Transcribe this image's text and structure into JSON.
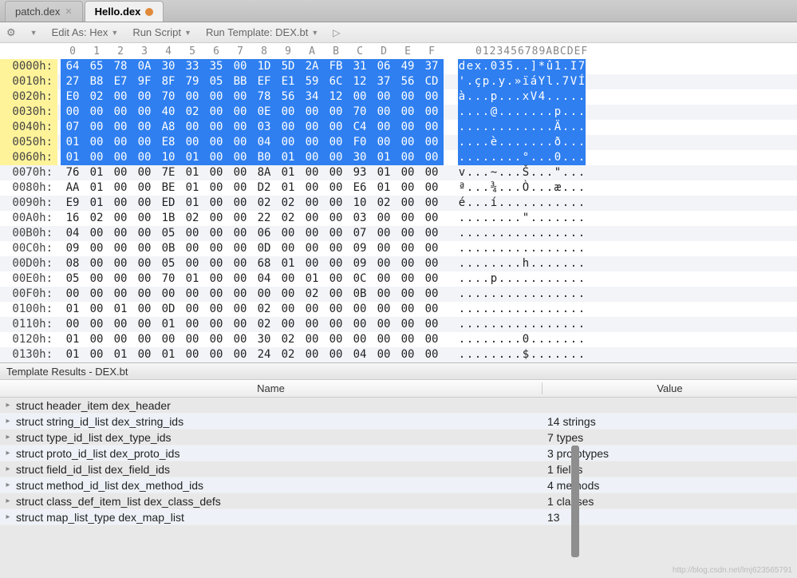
{
  "tabs": [
    {
      "label": "patch.dex",
      "active": false
    },
    {
      "label": "Hello.dex",
      "active": true,
      "dirty": true
    }
  ],
  "toolbar": {
    "edit_as": "Edit As: Hex",
    "run_script": "Run Script",
    "run_template": "Run Template: DEX.bt"
  },
  "hex_header": {
    "cols": [
      "0",
      "1",
      "2",
      "3",
      "4",
      "5",
      "6",
      "7",
      "8",
      "9",
      "A",
      "B",
      "C",
      "D",
      "E",
      "F"
    ],
    "ascii": "0123456789ABCDEF"
  },
  "rows": [
    {
      "addr": "0000h:",
      "hex": [
        "64",
        "65",
        "78",
        "0A",
        "30",
        "33",
        "35",
        "00",
        "1D",
        "5D",
        "2A",
        "FB",
        "31",
        "06",
        "49",
        "37"
      ],
      "asc": [
        "d",
        "e",
        "x",
        ".",
        "0",
        "3",
        "5",
        ".",
        ".",
        "]",
        "*",
        "û",
        "1",
        ".",
        "I",
        "7"
      ],
      "sel": true
    },
    {
      "addr": "0010h:",
      "hex": [
        "27",
        "B8",
        "E7",
        "9F",
        "8F",
        "79",
        "05",
        "BB",
        "EF",
        "E1",
        "59",
        "6C",
        "12",
        "37",
        "56",
        "CD"
      ],
      "asc": [
        "'",
        ".",
        "ç",
        "p",
        ".",
        "y",
        ".",
        "»",
        "ï",
        "á",
        "Y",
        "l",
        ".",
        "7",
        "V",
        "Í"
      ],
      "sel": true
    },
    {
      "addr": "0020h:",
      "hex": [
        "E0",
        "02",
        "00",
        "00",
        "70",
        "00",
        "00",
        "00",
        "78",
        "56",
        "34",
        "12",
        "00",
        "00",
        "00",
        "00"
      ],
      "asc": [
        "à",
        ".",
        ".",
        ".",
        "p",
        ".",
        ".",
        ".",
        "x",
        "V",
        "4",
        ".",
        ".",
        ".",
        ".",
        "."
      ],
      "sel": true
    },
    {
      "addr": "0030h:",
      "hex": [
        "00",
        "00",
        "00",
        "00",
        "40",
        "02",
        "00",
        "00",
        "0E",
        "00",
        "00",
        "00",
        "70",
        "00",
        "00",
        "00"
      ],
      "asc": [
        ".",
        ".",
        ".",
        ".",
        "@",
        ".",
        ".",
        ".",
        ".",
        ".",
        ".",
        ".",
        "p",
        ".",
        ".",
        "."
      ],
      "sel": true
    },
    {
      "addr": "0040h:",
      "hex": [
        "07",
        "00",
        "00",
        "00",
        "A8",
        "00",
        "00",
        "00",
        "03",
        "00",
        "00",
        "00",
        "C4",
        "00",
        "00",
        "00"
      ],
      "asc": [
        ".",
        ".",
        ".",
        ".",
        ".",
        ".",
        ".",
        ".",
        ".",
        ".",
        ".",
        ".",
        "Ä",
        ".",
        ".",
        "."
      ],
      "sel": true
    },
    {
      "addr": "0050h:",
      "hex": [
        "01",
        "00",
        "00",
        "00",
        "E8",
        "00",
        "00",
        "00",
        "04",
        "00",
        "00",
        "00",
        "F0",
        "00",
        "00",
        "00"
      ],
      "asc": [
        ".",
        ".",
        ".",
        ".",
        "è",
        ".",
        ".",
        ".",
        ".",
        ".",
        ".",
        ".",
        "ð",
        ".",
        ".",
        "."
      ],
      "sel": true
    },
    {
      "addr": "0060h:",
      "hex": [
        "01",
        "00",
        "00",
        "00",
        "10",
        "01",
        "00",
        "00",
        "B0",
        "01",
        "00",
        "00",
        "30",
        "01",
        "00",
        "00"
      ],
      "asc": [
        ".",
        ".",
        ".",
        ".",
        ".",
        ".",
        ".",
        ".",
        "°",
        ".",
        ".",
        ".",
        "0",
        ".",
        ".",
        "."
      ],
      "sel": true
    },
    {
      "addr": "0070h:",
      "hex": [
        "76",
        "01",
        "00",
        "00",
        "7E",
        "01",
        "00",
        "00",
        "8A",
        "01",
        "00",
        "00",
        "93",
        "01",
        "00",
        "00"
      ],
      "asc": [
        "v",
        ".",
        ".",
        ".",
        "~",
        ".",
        ".",
        ".",
        "Š",
        ".",
        ".",
        ".",
        "\"",
        ".",
        ".",
        "."
      ],
      "sel": false
    },
    {
      "addr": "0080h:",
      "hex": [
        "AA",
        "01",
        "00",
        "00",
        "BE",
        "01",
        "00",
        "00",
        "D2",
        "01",
        "00",
        "00",
        "E6",
        "01",
        "00",
        "00"
      ],
      "asc": [
        "ª",
        ".",
        ".",
        ".",
        "¾",
        ".",
        ".",
        ".",
        "Ò",
        ".",
        ".",
        ".",
        "æ",
        ".",
        ".",
        "."
      ],
      "sel": false
    },
    {
      "addr": "0090h:",
      "hex": [
        "E9",
        "01",
        "00",
        "00",
        "ED",
        "01",
        "00",
        "00",
        "02",
        "02",
        "00",
        "00",
        "10",
        "02",
        "00",
        "00"
      ],
      "asc": [
        "é",
        ".",
        ".",
        ".",
        "í",
        ".",
        ".",
        ".",
        ".",
        ".",
        ".",
        ".",
        ".",
        ".",
        ".",
        "."
      ],
      "sel": false
    },
    {
      "addr": "00A0h:",
      "hex": [
        "16",
        "02",
        "00",
        "00",
        "1B",
        "02",
        "00",
        "00",
        "22",
        "02",
        "00",
        "00",
        "03",
        "00",
        "00",
        "00"
      ],
      "asc": [
        ".",
        ".",
        ".",
        ".",
        ".",
        ".",
        ".",
        ".",
        "\"",
        ".",
        ".",
        ".",
        ".",
        ".",
        ".",
        "."
      ],
      "sel": false
    },
    {
      "addr": "00B0h:",
      "hex": [
        "04",
        "00",
        "00",
        "00",
        "05",
        "00",
        "00",
        "00",
        "06",
        "00",
        "00",
        "00",
        "07",
        "00",
        "00",
        "00"
      ],
      "asc": [
        ".",
        ".",
        ".",
        ".",
        ".",
        ".",
        ".",
        ".",
        ".",
        ".",
        ".",
        ".",
        ".",
        ".",
        ".",
        "."
      ],
      "sel": false
    },
    {
      "addr": "00C0h:",
      "hex": [
        "09",
        "00",
        "00",
        "00",
        "0B",
        "00",
        "00",
        "00",
        "0D",
        "00",
        "00",
        "00",
        "09",
        "00",
        "00",
        "00"
      ],
      "asc": [
        ".",
        ".",
        ".",
        ".",
        ".",
        ".",
        ".",
        ".",
        ".",
        ".",
        ".",
        ".",
        ".",
        ".",
        ".",
        "."
      ],
      "sel": false
    },
    {
      "addr": "00D0h:",
      "hex": [
        "08",
        "00",
        "00",
        "00",
        "05",
        "00",
        "00",
        "00",
        "68",
        "01",
        "00",
        "00",
        "09",
        "00",
        "00",
        "00"
      ],
      "asc": [
        ".",
        ".",
        ".",
        ".",
        ".",
        ".",
        ".",
        ".",
        "h",
        ".",
        ".",
        ".",
        ".",
        ".",
        ".",
        "."
      ],
      "sel": false
    },
    {
      "addr": "00E0h:",
      "hex": [
        "05",
        "00",
        "00",
        "00",
        "70",
        "01",
        "00",
        "00",
        "04",
        "00",
        "01",
        "00",
        "0C",
        "00",
        "00",
        "00"
      ],
      "asc": [
        ".",
        ".",
        ".",
        ".",
        "p",
        ".",
        ".",
        ".",
        ".",
        ".",
        ".",
        ".",
        ".",
        ".",
        ".",
        "."
      ],
      "sel": false
    },
    {
      "addr": "00F0h:",
      "hex": [
        "00",
        "00",
        "00",
        "00",
        "00",
        "00",
        "00",
        "00",
        "00",
        "00",
        "02",
        "00",
        "0B",
        "00",
        "00",
        "00"
      ],
      "asc": [
        ".",
        ".",
        ".",
        ".",
        ".",
        ".",
        ".",
        ".",
        ".",
        ".",
        ".",
        ".",
        ".",
        ".",
        ".",
        "."
      ],
      "sel": false
    },
    {
      "addr": "0100h:",
      "hex": [
        "01",
        "00",
        "01",
        "00",
        "0D",
        "00",
        "00",
        "00",
        "02",
        "00",
        "00",
        "00",
        "00",
        "00",
        "00",
        "00"
      ],
      "asc": [
        ".",
        ".",
        ".",
        ".",
        ".",
        ".",
        ".",
        ".",
        ".",
        ".",
        ".",
        ".",
        ".",
        ".",
        ".",
        "."
      ],
      "sel": false
    },
    {
      "addr": "0110h:",
      "hex": [
        "00",
        "00",
        "00",
        "00",
        "01",
        "00",
        "00",
        "00",
        "02",
        "00",
        "00",
        "00",
        "00",
        "00",
        "00",
        "00"
      ],
      "asc": [
        ".",
        ".",
        ".",
        ".",
        ".",
        ".",
        ".",
        ".",
        ".",
        ".",
        ".",
        ".",
        ".",
        ".",
        ".",
        "."
      ],
      "sel": false
    },
    {
      "addr": "0120h:",
      "hex": [
        "01",
        "00",
        "00",
        "00",
        "00",
        "00",
        "00",
        "00",
        "30",
        "02",
        "00",
        "00",
        "00",
        "00",
        "00",
        "00"
      ],
      "asc": [
        ".",
        ".",
        ".",
        ".",
        ".",
        ".",
        ".",
        ".",
        "0",
        ".",
        ".",
        ".",
        ".",
        ".",
        ".",
        "."
      ],
      "sel": false
    },
    {
      "addr": "0130h:",
      "hex": [
        "01",
        "00",
        "01",
        "00",
        "01",
        "00",
        "00",
        "00",
        "24",
        "02",
        "00",
        "00",
        "04",
        "00",
        "00",
        "00"
      ],
      "asc": [
        ".",
        ".",
        ".",
        ".",
        ".",
        ".",
        ".",
        ".",
        "$",
        ".",
        ".",
        ".",
        ".",
        ".",
        ".",
        "."
      ],
      "sel": false
    }
  ],
  "template_results": {
    "title": "Template Results - DEX.bt",
    "name_col": "Name",
    "value_col": "Value",
    "rows": [
      {
        "name": "struct header_item dex_header",
        "value": ""
      },
      {
        "name": "struct string_id_list dex_string_ids",
        "value": "14 strings"
      },
      {
        "name": "struct type_id_list dex_type_ids",
        "value": "7 types"
      },
      {
        "name": "struct proto_id_list dex_proto_ids",
        "value": "3 prototypes"
      },
      {
        "name": "struct field_id_list dex_field_ids",
        "value": "1 fields"
      },
      {
        "name": "struct method_id_list dex_method_ids",
        "value": "4 methods"
      },
      {
        "name": "struct class_def_item_list dex_class_defs",
        "value": "1 classes"
      },
      {
        "name": "struct map_list_type dex_map_list",
        "value": "13"
      }
    ]
  },
  "watermark": "http://blog.csdn.net/lmj623565791"
}
